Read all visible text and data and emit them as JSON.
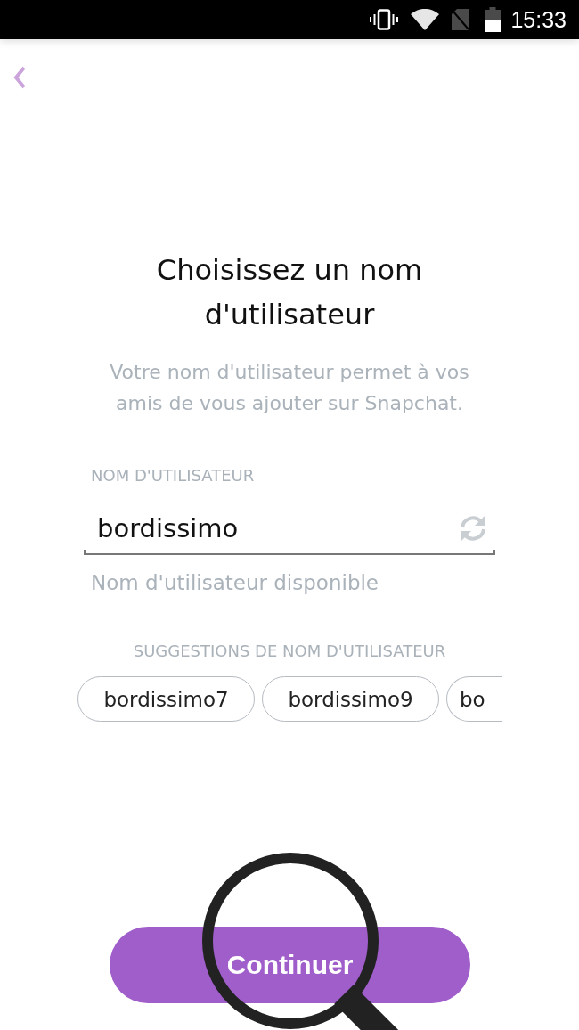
{
  "status_bar": {
    "time": "15:33"
  },
  "title": "Choisissez un nom d'utilisateur",
  "subtitle": "Votre nom d'utilisateur permet à vos amis de vous ajouter sur Snapchat.",
  "username_field": {
    "label": "NOM D'UTILISATEUR",
    "value": "bordissimo",
    "status": "Nom d'utilisateur disponible"
  },
  "suggestions": {
    "heading": "SUGGESTIONS DE NOM D'UTILISATEUR",
    "items": [
      {
        "label": "bordissimo7",
        "clipped": false
      },
      {
        "label": "bordissimo9",
        "clipped": false
      },
      {
        "label": "bo",
        "clipped": true
      }
    ]
  },
  "continue_button": {
    "label": "Continuer"
  }
}
